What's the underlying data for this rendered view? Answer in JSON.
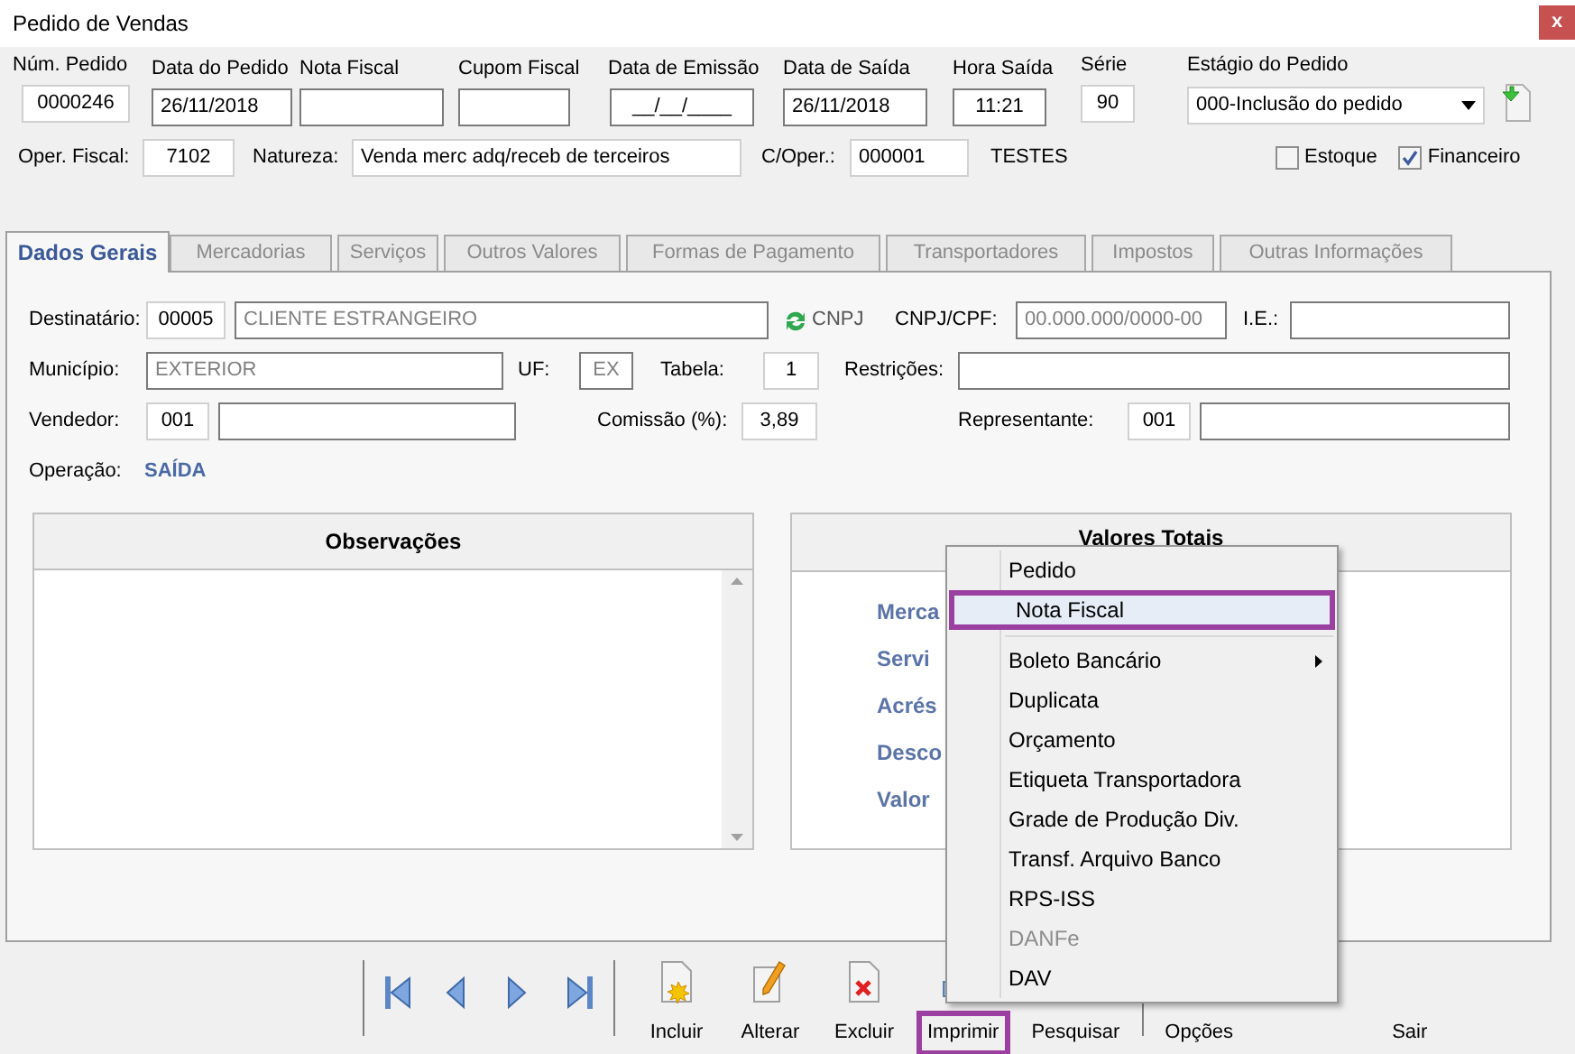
{
  "window": {
    "title": "Pedido de Vendas",
    "close": "x"
  },
  "header_fields": [
    {
      "label": "Núm. Pedido",
      "value": "0000246"
    },
    {
      "label": "Data do Pedido",
      "value": "26/11/2018"
    },
    {
      "label": "Nota Fiscal"
    },
    {
      "label": "Cupom Fiscal"
    },
    {
      "label": "Data de Emissão",
      "value": "__/__/____"
    },
    {
      "label": "Data de Saída",
      "value": "26/11/2018"
    },
    {
      "label": "Hora Saída",
      "value": "11:21"
    },
    {
      "label": "Série",
      "value": "90"
    }
  ],
  "stage": {
    "label": "Estágio do Pedido",
    "value": "000-Inclusão do pedido"
  },
  "oper_fiscal": {
    "label": "Oper. Fiscal:",
    "value": "7102"
  },
  "natureza": {
    "label": "Natureza:",
    "value": "Venda merc adq/receb de terceiros"
  },
  "c_oper": {
    "label": "C/Oper.:",
    "value": "000001",
    "description": "TESTES"
  },
  "checkboxes": [
    {
      "label": "Estoque",
      "checked": false
    },
    {
      "label": "Financeiro",
      "checked": true
    }
  ],
  "tabs": [
    {
      "label": "Dados Gerais",
      "selected": true
    },
    {
      "label": "Mercadorias",
      "selected": false
    },
    {
      "label": "Serviços",
      "selected": false
    },
    {
      "label": "Outros Valores",
      "selected": false
    },
    {
      "label": "Formas de Pagamento",
      "selected": false
    },
    {
      "label": "Transportadores",
      "selected": false
    },
    {
      "label": "Impostos",
      "selected": false
    },
    {
      "label": "Outras Informações",
      "selected": false
    }
  ],
  "general": {
    "destinatario": {
      "label": "Destinatário:",
      "code": "00005",
      "name": "CLIENTE ESTRANGEIRO",
      "toggle": "CNPJ"
    },
    "cnpj_cpf": {
      "label": "CNPJ/CPF:",
      "placeholder": "00.000.000/0000-00"
    },
    "ie": {
      "label": "I.E.:"
    },
    "municipio": {
      "label": "Município:",
      "value": "EXTERIOR"
    },
    "uf": {
      "label": "UF:",
      "value": "EX"
    },
    "tabela": {
      "label": "Tabela:",
      "value": "1"
    },
    "restricoes": {
      "label": "Restrições:"
    },
    "vendedor": {
      "label": "Vendedor:",
      "code": "001"
    },
    "comissao": {
      "label": "Comissão (%):",
      "value": "3,89"
    },
    "representante": {
      "label": "Representante:",
      "code": "001"
    },
    "operacao": {
      "label": "Operação:",
      "value": "SAÍDA"
    }
  },
  "observacoes": {
    "title": "Observações"
  },
  "valores_totais": {
    "title": "Valores Totais",
    "labels": [
      "Merca",
      "Servi",
      "Acrés",
      "Desco",
      "Valor"
    ]
  },
  "toolbar": {
    "actions": [
      {
        "label": "Incluir",
        "kind": "new",
        "selected": false
      },
      {
        "label": "Alterar",
        "kind": "edit",
        "selected": false
      },
      {
        "label": "Excluir",
        "kind": "delete",
        "selected": false
      },
      {
        "label": "Imprimir",
        "kind": "print",
        "selected": true
      },
      {
        "label": "Pesquisar",
        "kind": "search",
        "selected": false
      },
      {
        "label": "Opções",
        "kind": "options",
        "selected": false
      },
      {
        "label": "Sair",
        "kind": "exit",
        "selected": false
      }
    ]
  },
  "context_menu": {
    "items": [
      {
        "kind": "item",
        "label": "Pedido",
        "selected": false,
        "disabled": false,
        "submenu": false
      },
      {
        "kind": "item",
        "label": "Nota Fiscal",
        "selected": true,
        "disabled": false,
        "submenu": false
      },
      {
        "kind": "separator"
      },
      {
        "kind": "item",
        "label": "Boleto Bancário",
        "selected": false,
        "disabled": false,
        "submenu": true
      },
      {
        "kind": "item",
        "label": "Duplicata",
        "selected": false,
        "disabled": false,
        "submenu": false
      },
      {
        "kind": "item",
        "label": "Orçamento",
        "selected": false,
        "disabled": false,
        "submenu": false
      },
      {
        "kind": "item",
        "label": "Etiqueta Transportadora",
        "selected": false,
        "disabled": false,
        "submenu": false
      },
      {
        "kind": "item",
        "label": "Grade de Produção Div.",
        "selected": false,
        "disabled": false,
        "submenu": false
      },
      {
        "kind": "item",
        "label": "Transf. Arquivo Banco",
        "selected": false,
        "disabled": false,
        "submenu": false
      },
      {
        "kind": "item",
        "label": "RPS-ISS",
        "selected": false,
        "disabled": false,
        "submenu": false
      },
      {
        "kind": "item",
        "label": "DANFe",
        "selected": false,
        "disabled": true,
        "submenu": false
      },
      {
        "kind": "item",
        "label": "DAV",
        "selected": false,
        "disabled": false,
        "submenu": false
      }
    ]
  }
}
